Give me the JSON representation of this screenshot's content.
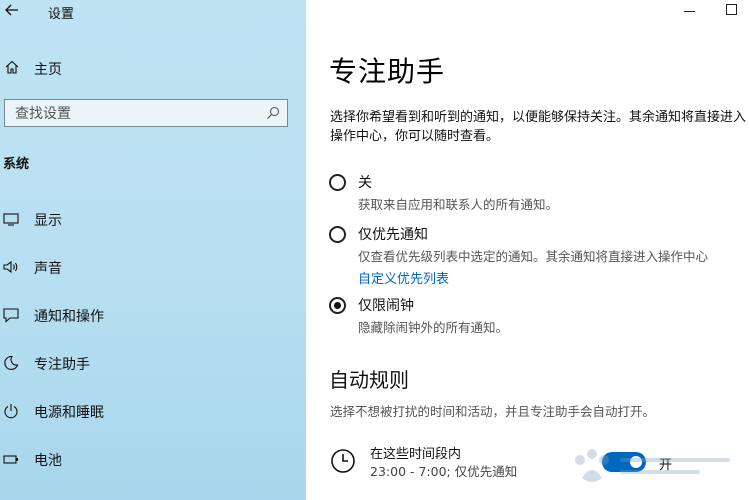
{
  "sidebar": {
    "app_title": "设置",
    "home_label": "主页",
    "search_placeholder": "查找设置",
    "section_title": "系统",
    "items": [
      {
        "label": "显示",
        "icon": "monitor-icon"
      },
      {
        "label": "声音",
        "icon": "speaker-icon"
      },
      {
        "label": "通知和操作",
        "icon": "notification-icon"
      },
      {
        "label": "专注助手",
        "icon": "moon-icon"
      },
      {
        "label": "电源和睡眠",
        "icon": "power-icon"
      },
      {
        "label": "电池",
        "icon": "battery-icon"
      }
    ]
  },
  "main": {
    "title": "专注助手",
    "description": "选择你希望看到和听到的通知，以便能够保持关注。其余通知将直接进入操作中心，你可以随时查看。",
    "options": [
      {
        "label": "关",
        "sub": "获取来自应用和联系人的所有通知。",
        "checked": false
      },
      {
        "label": "仅优先通知",
        "sub": "仅查看优先级列表中选定的通知。其余通知将直接进入操作中心",
        "link": "自定义优先列表",
        "checked": false
      },
      {
        "label": "仅限闹钟",
        "sub": "隐藏除闹钟外的所有通知。",
        "checked": true
      }
    ],
    "auto_rules": {
      "title": "自动规则",
      "description": "选择不想被打扰的时间和活动，并且专注助手会自动打开。",
      "rule": {
        "title": "在这些时间段内",
        "sub": "23:00 - 7:00; 仅优先通知",
        "toggle_label": "开",
        "toggle_on": true
      }
    }
  },
  "colors": {
    "accent": "#0067c0",
    "sidebar_bg": "#bfe3f3"
  }
}
